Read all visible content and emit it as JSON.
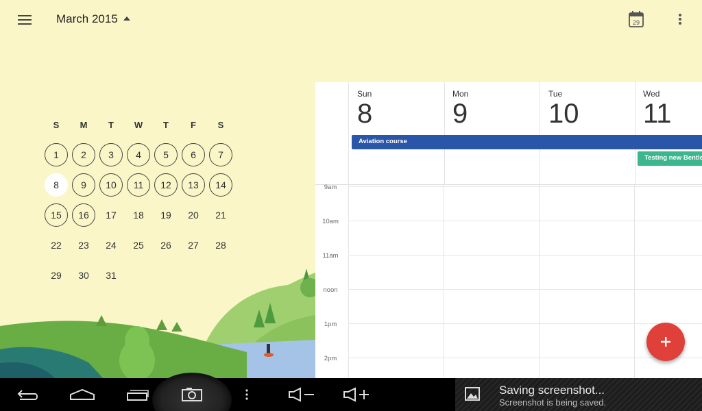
{
  "header": {
    "month_label": "March 2015",
    "today_badge": "29"
  },
  "mini_month": {
    "weekday_labels": [
      "S",
      "M",
      "T",
      "W",
      "T",
      "F",
      "S"
    ],
    "weeks": [
      [
        "1",
        "2",
        "3",
        "4",
        "5",
        "6",
        "7"
      ],
      [
        "8",
        "9",
        "10",
        "11",
        "12",
        "13",
        "14"
      ],
      [
        "15",
        "16",
        "17",
        "18",
        "19",
        "20",
        "21"
      ],
      [
        "22",
        "23",
        "24",
        "25",
        "26",
        "27",
        "28"
      ],
      [
        "29",
        "30",
        "31",
        "",
        "",
        "",
        ""
      ]
    ],
    "selected_day": "8"
  },
  "week_view": {
    "days": [
      {
        "name": "Sun",
        "number": "8"
      },
      {
        "name": "Mon",
        "number": "9"
      },
      {
        "name": "Tue",
        "number": "10"
      },
      {
        "name": "Wed",
        "number": "11"
      }
    ],
    "events": [
      {
        "title": "Aviation course",
        "color": "#2a56a9"
      },
      {
        "title": "Testing new Bentley",
        "color": "#3cb68e"
      }
    ],
    "hours": [
      "9am",
      "10am",
      "11am",
      "noon",
      "1pm",
      "2pm"
    ]
  },
  "notification": {
    "title": "Saving screenshot...",
    "subtitle": "Screenshot is being saved."
  },
  "colors": {
    "background": "#faf6c8",
    "fab": "#e0403a",
    "aviation_event": "#2a56a9",
    "testing_event": "#3cb68e"
  }
}
